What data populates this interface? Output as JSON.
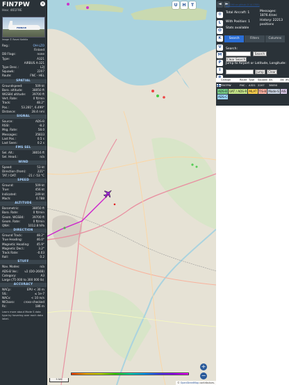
{
  "aircraft": {
    "callsign": "FIN7PW",
    "hex_label": "Hex: 461F9E",
    "photo_credit": "Image © Rasmi Kokkila",
    "close_icon": "×"
  },
  "details": [
    {
      "k": "Reg.:",
      "v": "OH-LZO",
      "link": true
    },
    {
      "k": "",
      "v": "Finland"
    },
    {
      "k": "DB Flags:",
      "v": "none"
    },
    {
      "k": "Type:",
      "v": "A321"
    },
    {
      "k": "",
      "v": "AIRBUS A-321"
    },
    {
      "k": "Type Desc.:",
      "v": "L2J"
    },
    {
      "k": "Squawk:",
      "v": "2207"
    },
    {
      "k": "Route:",
      "v": "FNC - HEL"
    }
  ],
  "sections": [
    {
      "title": "SPATIAL",
      "rows": [
        {
          "k": "Groundspeed:",
          "v": "509 kt"
        },
        {
          "k": "Baro. altitude:",
          "v": "38050 ft"
        },
        {
          "k": "WGS84 altitude:",
          "v": "39700 ft"
        },
        {
          "k": "Vert. Rate:",
          "v": "0 ft/min"
        },
        {
          "k": "Track:",
          "v": "48.2°"
        },
        {
          "k": "Pos.:",
          "v": "53.281°, 6.499°"
        },
        {
          "k": "Distance:",
          "v": "28.4 nmi"
        }
      ]
    },
    {
      "title": "SIGNAL",
      "rows": [
        {
          "k": "Source:",
          "v": "ADS-B"
        },
        {
          "k": "RSSI:",
          "v": "-8.2"
        },
        {
          "k": "Msg. Rate:",
          "v": "58.0"
        },
        {
          "k": "Messages:",
          "v": "35833"
        },
        {
          "k": "Last Pos.:",
          "v": "0.5 s"
        },
        {
          "k": "Last Seen:",
          "v": "0.2 s"
        }
      ]
    },
    {
      "title": "FMS SEL",
      "rows": [
        {
          "k": "Sel. Alt.:",
          "v": "38016 ft"
        },
        {
          "k": "Sel. Head.:",
          "v": "n/a"
        }
      ]
    },
    {
      "title": "WIND",
      "rows": [
        {
          "k": "Speed:",
          "v": "53 kt"
        },
        {
          "k": "Direction (from):",
          "v": "221°"
        },
        {
          "k": "TAT / OAT:",
          "v": "-21 / -53 °C"
        }
      ]
    },
    {
      "title": "SPEED",
      "rows": [
        {
          "k": "Ground:",
          "v": "509 kt"
        },
        {
          "k": "True:",
          "v": "456 kt"
        },
        {
          "k": "Indicated:",
          "v": "249 kt"
        },
        {
          "k": "Mach:",
          "v": "0.788"
        }
      ]
    },
    {
      "title": "ALTITUDE",
      "rows": [
        {
          "k": "Barometric:",
          "v": "38050 ft"
        },
        {
          "k": "Baro. Rate:",
          "v": "0 ft/min"
        },
        {
          "k": "Geom. WGS84:",
          "v": "39700 ft"
        },
        {
          "k": "Geom. Rate:",
          "v": "0 ft/min"
        },
        {
          "k": "QNH:",
          "v": "1012.8 hPa"
        }
      ]
    },
    {
      "title": "DIRECTION",
      "rows": [
        {
          "k": "Ground Track:",
          "v": "48.2°"
        },
        {
          "k": "True Heading:",
          "v": "46.0°"
        },
        {
          "k": "Magnetic Heading:",
          "v": "45.9°"
        },
        {
          "k": "Magnetic Decl.:",
          "v": "3.2°"
        },
        {
          "k": "Track Rate:",
          "v": "-0.03"
        },
        {
          "k": "Roll:",
          "v": "0.2"
        }
      ]
    },
    {
      "title": "STUFF",
      "rows": [
        {
          "k": "Nav. Modes:",
          "v": "n/a"
        },
        {
          "k": "ADS-B Ver.:",
          "v": "v2 (DO-260B)"
        },
        {
          "k": "Category:",
          "v": "A3"
        }
      ]
    }
  ],
  "category_desc": "Large (75 000 to 300 000 lb)",
  "accuracy": {
    "title": "ACCURACY",
    "rows": [
      {
        "k": "NACp:",
        "v": "EPU < 30 m"
      },
      {
        "k": "SIL:",
        "v": "≤ 1e-7"
      },
      {
        "k": "NACv:",
        "v": "< 10 m/s"
      },
      {
        "k": "NICbaro:",
        "v": "cross-checked"
      },
      {
        "k": "Rc:",
        "v": "186 m"
      }
    ]
  },
  "footnote": "Learn more about Mode S data type by hovering over each data label.",
  "map": {
    "controls": [
      "U",
      "H",
      "T"
    ],
    "scale_label": "5 NM",
    "attribution_prefix": "© ",
    "attribution_link": "OpenStreetMap",
    "attribution_suffix": " contributors.",
    "zoom_in": "+",
    "zoom_out": "−",
    "legend_ticks": [
      "",
      "",
      "",
      "",
      "",
      "",
      "",
      ""
    ]
  },
  "sidebar": {
    "nav": [
      "◄",
      "►",
      "⚙",
      "L",
      "O",
      "K",
      "V",
      "M",
      "P",
      "I",
      "R"
    ],
    "source_link": "tar1090 on github (3.14.1705)",
    "stats": {
      "total_aircraft_label": "Total Aircraft: 1",
      "with_positions_label": "With Position: 1",
      "stats_available": "Stats available",
      "messages_label": "Messages:",
      "messages_value": "1876.4/sec",
      "history_label": "History: 22213",
      "history_value": "positions"
    },
    "tabs": [
      "Search",
      "Filters",
      "Columns"
    ],
    "search_label": "Search:",
    "search_button": "Search",
    "clear_search": "Clear Search",
    "jump_label": "Jump to Airport or Latitude, Longitude:",
    "jump_button": "Jump",
    "clear_button": "Clear",
    "table_headers": [
      "",
      "Callsign",
      "Route",
      "Type",
      "Squawk",
      "Alt.",
      "Alt. (ft)"
    ],
    "table_rows": [
      {
        "callsign": "FIN7PW",
        "route": "FNC - HEL",
        "type": "A321",
        "squawk": "2207",
        "alt": "38050"
      }
    ],
    "chips": [
      {
        "label": "ADS-B",
        "color": "#7bd38c"
      },
      {
        "label": "UAT / ADS-R",
        "color": "#c6e68a"
      },
      {
        "label": "MLAT",
        "color": "#ffd24d"
      },
      {
        "label": "TIS-B",
        "color": "#ffb3a3"
      },
      {
        "label": "Mode-S",
        "color": "#c8d2e0"
      },
      {
        "label": "AIS",
        "color": "#d8c8e6"
      },
      {
        "label": "ADS-C",
        "color": "#9bd6ff"
      }
    ]
  }
}
